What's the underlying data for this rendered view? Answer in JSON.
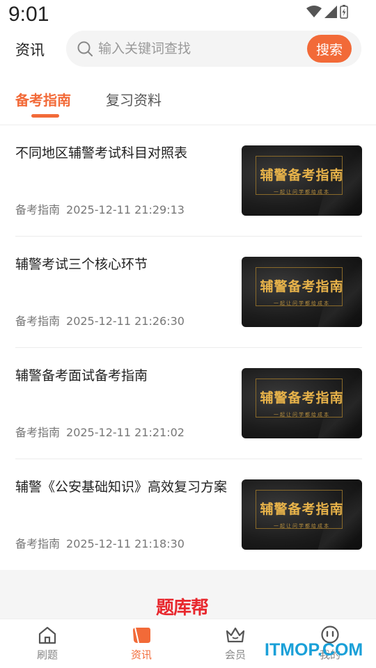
{
  "status_bar": {
    "time": "9:01"
  },
  "header": {
    "title": "资讯",
    "search_placeholder": "输入关键词查找",
    "search_button": "搜索"
  },
  "tabs": [
    {
      "label": "备考指南",
      "active": true
    },
    {
      "label": "复习资料",
      "active": false
    }
  ],
  "articles": [
    {
      "title": "不同地区辅警考试科目对照表",
      "category": "备考指南",
      "datetime": "2025-12-11 21:29:13",
      "thumb_title": "辅警备考指南",
      "thumb_sub": "一起让问学都给成本"
    },
    {
      "title": "辅警考试三个核心环节",
      "category": "备考指南",
      "datetime": "2025-12-11 21:26:30",
      "thumb_title": "辅警备考指南",
      "thumb_sub": "一起让问学都给成本"
    },
    {
      "title": "辅警备考面试备考指南",
      "category": "备考指南",
      "datetime": "2025-12-11 21:21:02",
      "thumb_title": "辅警备考指南",
      "thumb_sub": "一起让问学都给成本"
    },
    {
      "title": "辅警《公安基础知识》高效复习方案",
      "category": "备考指南",
      "datetime": "2025-12-11 21:18:30",
      "thumb_title": "辅警备考指南",
      "thumb_sub": "一起让问学都给成本"
    }
  ],
  "brand": {
    "logo_text": "题库帮"
  },
  "bottom_nav": [
    {
      "label": "刷题",
      "icon": "home-icon",
      "active": false
    },
    {
      "label": "资讯",
      "icon": "news-icon",
      "active": true
    },
    {
      "label": "会员",
      "icon": "crown-icon",
      "active": false
    },
    {
      "label": "我的",
      "icon": "face-icon",
      "active": false
    }
  ],
  "watermark": "ITMOP.COM",
  "colors": {
    "accent": "#f26a38",
    "brand_red": "#e8272d",
    "watermark": "#1aa0d8"
  }
}
